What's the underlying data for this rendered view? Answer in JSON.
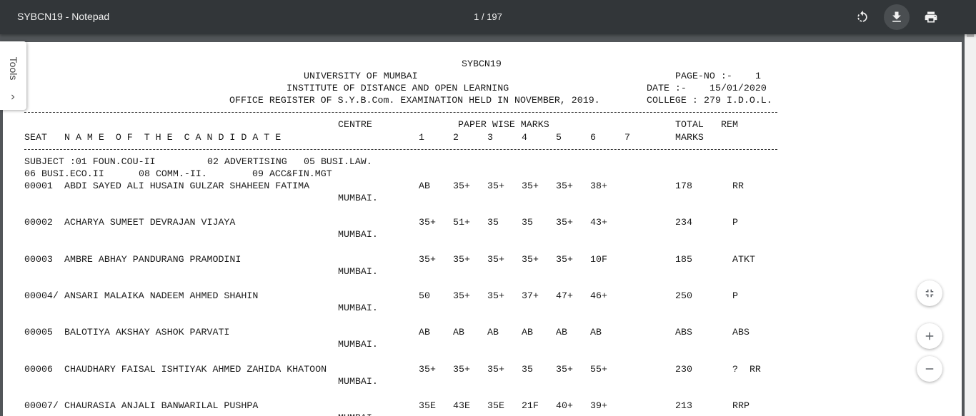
{
  "toolbar": {
    "title": "SYBCN19 - Notepad",
    "page_current": "1",
    "page_total": "197",
    "icons": [
      "rotate-icon",
      "download-icon",
      "print-icon"
    ]
  },
  "tools_tab": {
    "label": "Tools"
  },
  "document": {
    "header": {
      "code": "SYBCN19",
      "university": "UNIVERSITY OF MUMBAI",
      "institute": "INSTITUTE OF DISTANCE AND OPEN LEARNING",
      "register": "OFFICE REGISTER OF S.Y.B.Com. EXAMINATION HELD IN NOVEMBER, 2019.",
      "page_no_label": "PAGE-NO :-",
      "page_no_value": "1",
      "date_label": "DATE :-",
      "date_value": "15/01/2020",
      "college_label": "COLLEGE :",
      "college_value": "279 I.D.O.L."
    },
    "columns": {
      "seat": "SEAT",
      "name": "N A M E  O F  T H E  C A N D I D A T E",
      "centre": "CENTRE",
      "paper_wise": "PAPER WISE MARKS",
      "papers": [
        "1",
        "2",
        "3",
        "4",
        "5",
        "6",
        "7"
      ],
      "total_line1": "TOTAL",
      "total_line2": "MARKS",
      "rem": "REM"
    },
    "subjects": {
      "line1": [
        "SUBJECT :01 FOUN.COU-II",
        "02 ADVERTISING",
        "05 BUSI.LAW."
      ],
      "line2": [
        "06 BUSI.ECO.II",
        "08 COMM.-II.",
        "09 ACC&FIN.MGT"
      ]
    },
    "records": [
      {
        "seat": "00001",
        "name": "ABDI SAYED ALI HUSAIN GULZAR SHAHEEN FATIMA",
        "centre": "MUMBAI.",
        "marks": [
          "AB",
          "35+",
          "35+",
          "35+",
          "35+",
          "38+"
        ],
        "total": "178",
        "rem": "RR"
      },
      {
        "seat": "00002",
        "name": "ACHARYA SUMEET DEVRAJAN VIJAYA",
        "centre": "MUMBAI.",
        "marks": [
          "35+",
          "51+",
          "35",
          "35",
          "35+",
          "43+"
        ],
        "total": "234",
        "rem": "P"
      },
      {
        "seat": "00003",
        "name": "AMBRE ABHAY PANDURANG PRAMODINI",
        "centre": "MUMBAI.",
        "marks": [
          "35+",
          "35+",
          "35+",
          "35+",
          "35+",
          "10F"
        ],
        "total": "185",
        "rem": "ATKT"
      },
      {
        "seat": "00004/",
        "name": "ANSARI MALAIKA NADEEM AHMED SHAHIN",
        "centre": "MUMBAI.",
        "marks": [
          "50",
          "35+",
          "35+",
          "37+",
          "47+",
          "46+"
        ],
        "total": "250",
        "rem": "P"
      },
      {
        "seat": "00005",
        "name": "BALOTIYA AKSHAY ASHOK PARVATI",
        "centre": "MUMBAI.",
        "marks": [
          "AB",
          "AB",
          "AB",
          "AB",
          "AB",
          "AB"
        ],
        "total": "ABS",
        "rem": "ABS"
      },
      {
        "seat": "00006",
        "name": "CHAUDHARY FAISAL ISHTIYAK AHMED ZAHIDA KHATOON",
        "centre": "MUMBAI.",
        "marks": [
          "35+",
          "35+",
          "35+",
          "35",
          "35+",
          "55+"
        ],
        "total": "230",
        "rem": "?  RR"
      },
      {
        "seat": "00007/",
        "name": "CHAURASIA ANJALI BANWARILAL PUSHPA",
        "centre": "MUMBAI.",
        "marks": [
          "35E",
          "43E",
          "35E",
          "21F",
          "40+",
          "39+"
        ],
        "total": "213",
        "rem": "RRP"
      }
    ]
  }
}
